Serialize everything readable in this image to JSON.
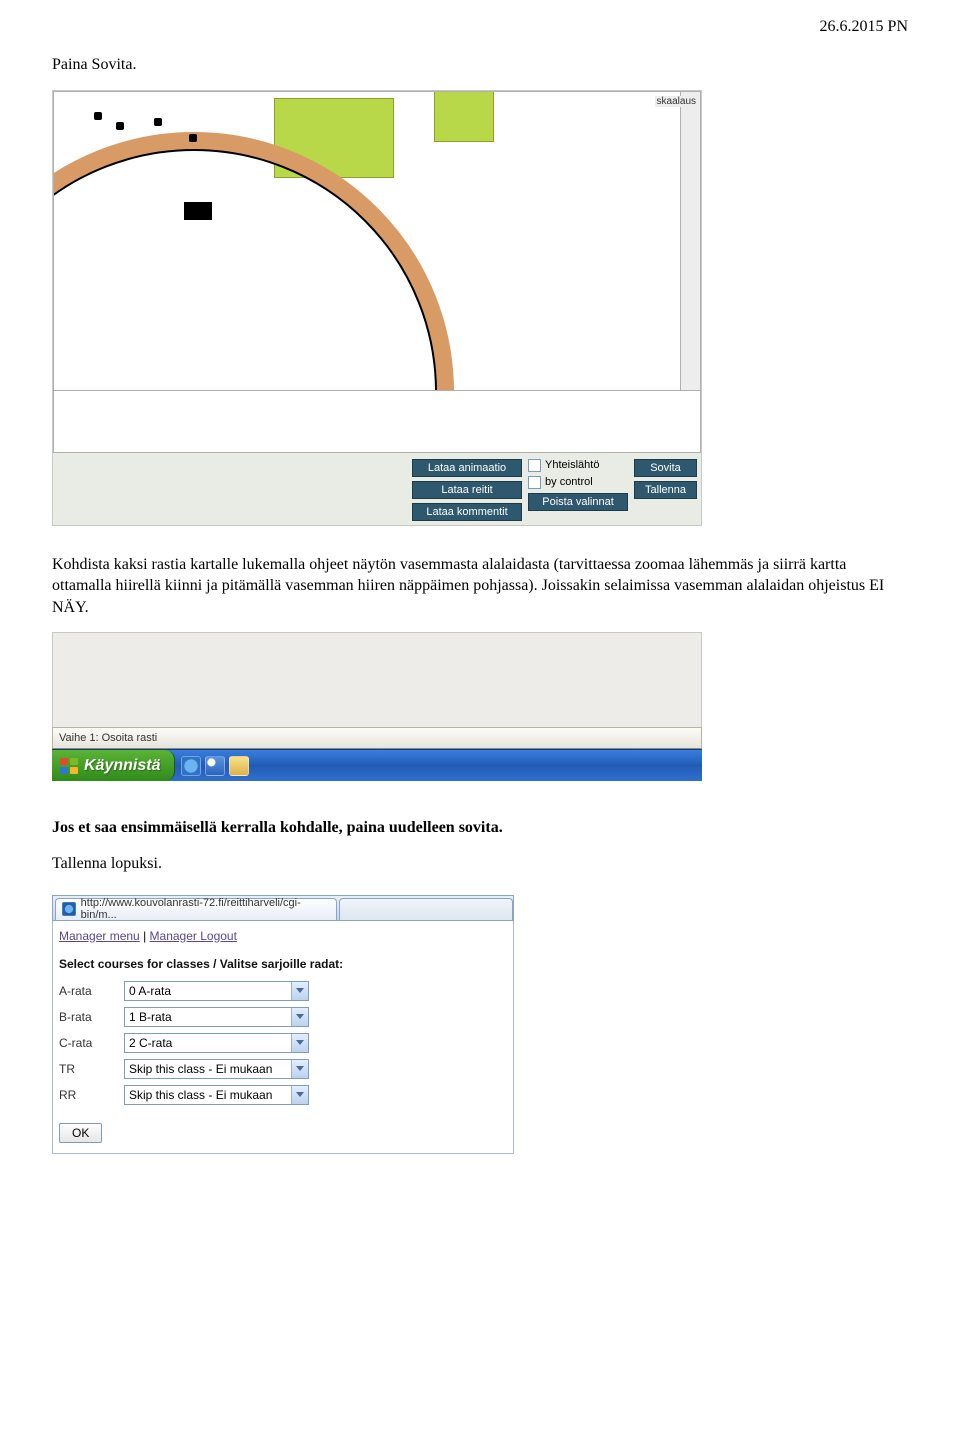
{
  "header": {
    "date": "26.6.2015 PN"
  },
  "intro": {
    "line1": "Paina Sovita."
  },
  "shot1": {
    "rail_label": "skaalaus",
    "col1": {
      "b1": "Lataa animaatio",
      "b2": "Lataa reitit",
      "b3": "Lataa kommentit"
    },
    "col2": {
      "c1": "Yhteislähtö",
      "c2": "by control",
      "b1": "Poista valinnat"
    },
    "col3": {
      "b1": "Sovita",
      "b2": "Tallenna"
    }
  },
  "para2": "Kohdista kaksi rastia kartalle lukemalla ohjeet näytön vasemmasta alalaidasta (tarvittaessa zoomaa lähemmäs ja siirrä kartta ottamalla hiirellä kiinni ja pitämällä vasemman hiiren näppäimen pohjassa). Joissakin selaimissa vasemman alalaidan ohjeistus EI NÄY.",
  "shot2": {
    "status": "Vaihe 1: Osoita rasti",
    "start": "Käynnistä"
  },
  "para3": "Jos et saa ensimmäisellä kerralla kohdalle, paina uudelleen sovita.",
  "para4": "Tallenna lopuksi.",
  "shot3": {
    "tab_url": "http://www.kouvolanrasti-72.fi/reittiharveli/cgi-bin/m...",
    "link1": "Manager menu",
    "link_sep": "|",
    "link2": "Manager Logout",
    "section": "Select courses for classes / Valitse sarjoille radat:",
    "rows": [
      {
        "label": "A-rata",
        "value": "0 A-rata"
      },
      {
        "label": "B-rata",
        "value": "1 B-rata"
      },
      {
        "label": "C-rata",
        "value": "2 C-rata"
      },
      {
        "label": "TR",
        "value": "Skip this class - Ei mukaan"
      },
      {
        "label": "RR",
        "value": "Skip this class - Ei mukaan"
      }
    ],
    "ok": "OK"
  }
}
